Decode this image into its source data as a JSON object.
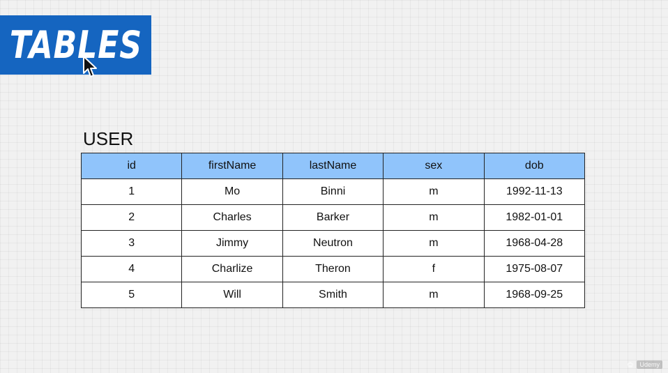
{
  "colors": {
    "banner_bg": "#1565c0",
    "header_bg": "#90c4fb",
    "cell_bg": "#ffffff",
    "border": "#222222"
  },
  "banner": {
    "title": "TABLES"
  },
  "table": {
    "caption": "USER",
    "columns": [
      "id",
      "firstName",
      "lastName",
      "sex",
      "dob"
    ],
    "rows": [
      [
        "1",
        "Mo",
        "Binni",
        "m",
        "1992-11-13"
      ],
      [
        "2",
        "Charles",
        "Barker",
        "m",
        "1982-01-01"
      ],
      [
        "3",
        "Jimmy",
        "Neutron",
        "m",
        "1968-04-28"
      ],
      [
        "4",
        "Charlize",
        "Theron",
        "f",
        "1975-08-07"
      ],
      [
        "5",
        "Will",
        "Smith",
        "m",
        "1968-09-25"
      ]
    ]
  },
  "watermark": {
    "text": "Udemy",
    "icon": "udemy-logo-icon"
  },
  "cursor": {
    "icon": "mouse-pointer-icon"
  }
}
